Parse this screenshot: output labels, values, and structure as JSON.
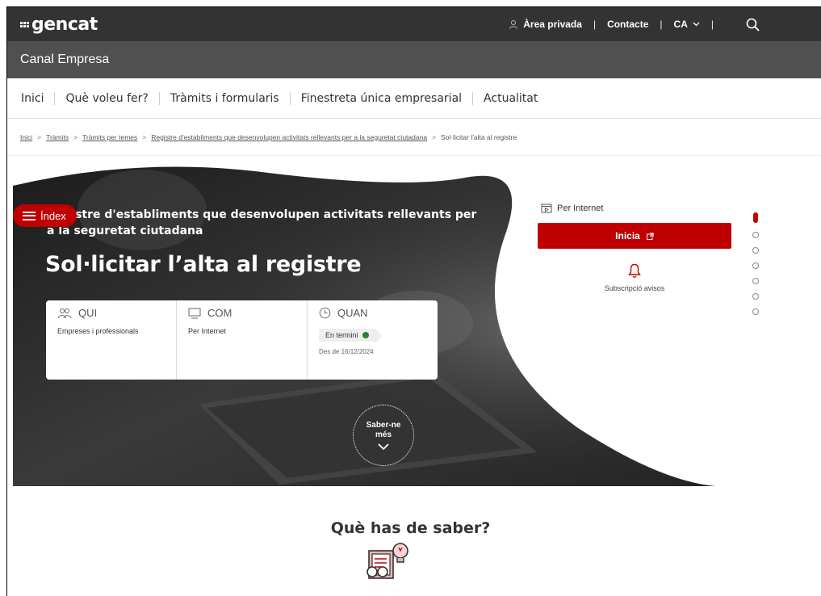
{
  "topbar": {
    "logo": "gencat",
    "private_area": "Àrea privada",
    "contact": "Contacte",
    "language": "CA"
  },
  "site": {
    "title": "Canal Empresa"
  },
  "nav": {
    "items": [
      {
        "label": "Inici"
      },
      {
        "label": "Què voleu fer?"
      },
      {
        "label": "Tràmits i formularis"
      },
      {
        "label": "Finestreta única empresarial"
      },
      {
        "label": "Actualitat"
      }
    ]
  },
  "breadcrumb": {
    "items": [
      {
        "label": "Inici"
      },
      {
        "label": "Tràmits"
      },
      {
        "label": "Tràmits per temes"
      },
      {
        "label": "Registre d'establiments que desenvolupen activitats rellevants per a la seguretat ciutadana"
      }
    ],
    "current": "Sol·licitar l'alta al registre"
  },
  "hero": {
    "index_label": "Índex",
    "subtitle": "Registre d'establiments que desenvolupen activitats rellevants per a la seguretat ciutadana",
    "title": "Sol·licitar l’alta al registre",
    "more_line1": "Saber-ne",
    "more_line2": "més"
  },
  "card": {
    "qui_label": "QUI",
    "qui_value": "Empreses i professionals",
    "com_label": "COM",
    "com_value": "Per Internet",
    "quan_label": "QUAN",
    "quan_status": "En termini",
    "quan_date": "Des de 16/12/2024"
  },
  "side": {
    "channel": "Per Internet",
    "start_button": "Inicia",
    "subscribe": "Subscripció avisos",
    "accent": "#c00000"
  },
  "section": {
    "title": "Què has de saber?"
  }
}
